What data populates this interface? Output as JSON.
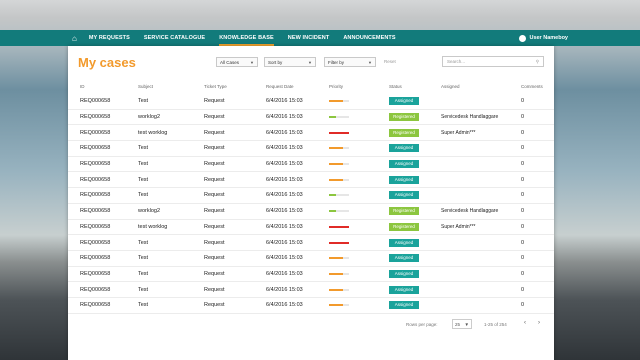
{
  "nav": {
    "items": [
      "MY REQUESTS",
      "SERVICE CATALOGUE",
      "KNOWLEDGE BASE",
      "NEW INCIDENT",
      "ANNOUNCEMENTS"
    ],
    "active": 2,
    "user": "User Nameboy"
  },
  "page": {
    "title": "My cases"
  },
  "filters": {
    "cases": "All Cases",
    "sort": "Sort by",
    "filter": "Filter by",
    "reset": "Reset",
    "search_placeholder": "Search..."
  },
  "table": {
    "columns": [
      "ID",
      "Subject",
      "Ticket Type",
      "Request Date",
      "Priority",
      "Status",
      "Assigned",
      "Comments"
    ],
    "status_colors": {
      "Assigned": "#1aa39b",
      "Registered": "#8cc63f"
    },
    "priority_colors": {
      "low": "#8cc63f",
      "medium": "#f29a2c",
      "high": "#e02b27"
    },
    "rows": [
      {
        "id": "REQ000658",
        "subject": "Test",
        "type": "Request",
        "date": "6/4/2016 15:03",
        "priority": "medium",
        "status": "Assigned",
        "assigned": "",
        "comments": "0"
      },
      {
        "id": "REQ000658",
        "subject": "worklog2",
        "type": "Request",
        "date": "6/4/2016 15:03",
        "priority": "low",
        "status": "Registered",
        "assigned": "Servicedesk Handlaggare",
        "comments": "0"
      },
      {
        "id": "REQ000658",
        "subject": "test worklog",
        "type": "Request",
        "date": "6/4/2016 15:03",
        "priority": "high",
        "status": "Registered",
        "assigned": "Super Admin***",
        "comments": "0"
      },
      {
        "id": "REQ000658",
        "subject": "Test",
        "type": "Request",
        "date": "6/4/2016 15:03",
        "priority": "medium",
        "status": "Assigned",
        "assigned": "",
        "comments": "0"
      },
      {
        "id": "REQ000658",
        "subject": "Test",
        "type": "Request",
        "date": "6/4/2016 15:03",
        "priority": "medium",
        "status": "Assigned",
        "assigned": "",
        "comments": "0"
      },
      {
        "id": "REQ000658",
        "subject": "Test",
        "type": "Request",
        "date": "6/4/2016 15:03",
        "priority": "medium",
        "status": "Assigned",
        "assigned": "",
        "comments": "0"
      },
      {
        "id": "REQ000658",
        "subject": "Test",
        "type": "Request",
        "date": "6/4/2016 15:03",
        "priority": "low",
        "status": "Assigned",
        "assigned": "",
        "comments": "0"
      },
      {
        "id": "REQ000658",
        "subject": "worklog2",
        "type": "Request",
        "date": "6/4/2016 15:03",
        "priority": "low",
        "status": "Registered",
        "assigned": "Servicedesk Handlaggare",
        "comments": "0"
      },
      {
        "id": "REQ000658",
        "subject": "test worklog",
        "type": "Request",
        "date": "6/4/2016 15:03",
        "priority": "high",
        "status": "Registered",
        "assigned": "Super Admin***",
        "comments": "0"
      },
      {
        "id": "REQ000658",
        "subject": "Test",
        "type": "Request",
        "date": "6/4/2016 15:03",
        "priority": "high",
        "status": "Assigned",
        "assigned": "",
        "comments": "0"
      },
      {
        "id": "REQ000658",
        "subject": "Test",
        "type": "Request",
        "date": "6/4/2016 15:03",
        "priority": "medium",
        "status": "Assigned",
        "assigned": "",
        "comments": "0"
      },
      {
        "id": "REQ000658",
        "subject": "Test",
        "type": "Request",
        "date": "6/4/2016 15:03",
        "priority": "medium",
        "status": "Assigned",
        "assigned": "",
        "comments": "0"
      },
      {
        "id": "REQ000658",
        "subject": "Test",
        "type": "Request",
        "date": "6/4/2016 15:03",
        "priority": "medium",
        "status": "Assigned",
        "assigned": "",
        "comments": "0"
      },
      {
        "id": "REQ000658",
        "subject": "Test",
        "type": "Request",
        "date": "6/4/2016 15:03",
        "priority": "medium",
        "status": "Assigned",
        "assigned": "",
        "comments": "0"
      }
    ]
  },
  "pagination": {
    "rows_label": "Rows per page:",
    "rows_value": "25",
    "range": "1-25 of 254"
  }
}
